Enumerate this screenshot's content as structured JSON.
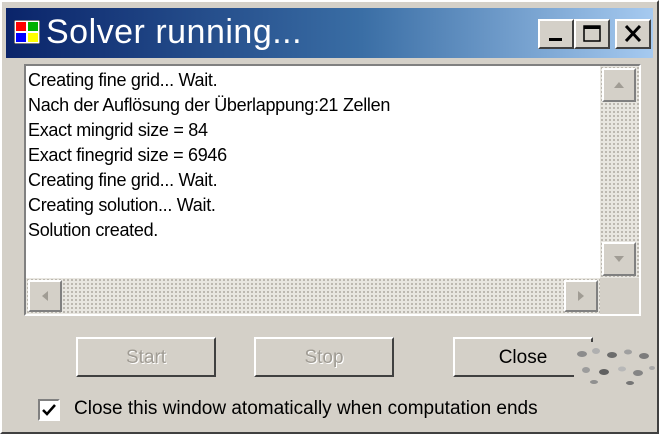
{
  "window": {
    "title": "Solver running...",
    "title_bar_colors": [
      "#0a246a",
      "#a6caf0"
    ],
    "caption_buttons": [
      "minimize-icon",
      "maximize-icon",
      "close-icon"
    ]
  },
  "log": {
    "lines": [
      "Creating fine grid... Wait.",
      "Nach der Auflösung der Überlappung:21 Zellen",
      "Exact mingrid size = 84",
      "Exact finegrid size = 6946",
      "Creating fine grid... Wait.",
      "Creating solution... Wait.",
      "Solution created."
    ]
  },
  "buttons": {
    "start_label": "Start",
    "stop_label": "Stop",
    "close_label": "Close"
  },
  "auto_close": {
    "label": "Close this window atomatically when computation ends",
    "checked": true
  }
}
